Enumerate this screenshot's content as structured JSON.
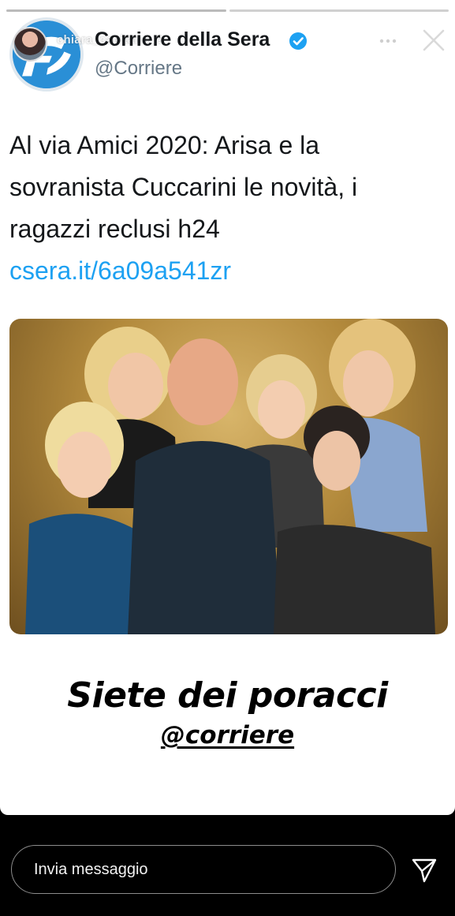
{
  "story": {
    "username": "chiara_capitano_?",
    "progress_segments": 2
  },
  "tweet": {
    "display_name": "Corriere della Sera",
    "handle": "@Corriere",
    "text": "Al via Amici 2020: Arisa e la sovranista Cuccarini le novità, i ragazzi reclusi h24 ",
    "link": "csera.it/6a09a541zr",
    "link_color": "#1da1f2",
    "logo_color": "#2a8fd6"
  },
  "sticker": {
    "main_text": "Siete dei poracci",
    "mention": "@corriere"
  },
  "reply": {
    "placeholder": "Invia messaggio"
  },
  "icons": {
    "verified": "verified-badge-icon",
    "more": "more-dots-icon",
    "close": "close-icon",
    "send": "send-paper-plane-icon"
  }
}
